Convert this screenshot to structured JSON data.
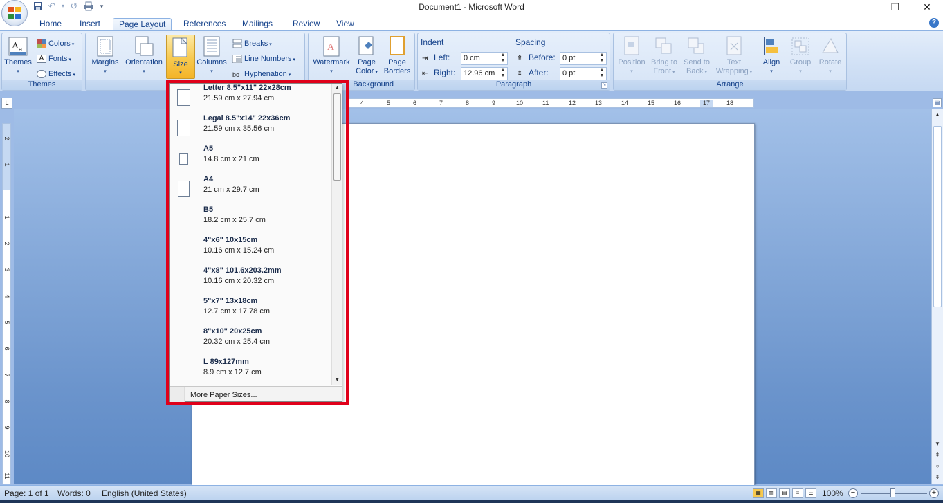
{
  "window": {
    "title": "Document1 - Microsoft Word"
  },
  "tabs": [
    "Home",
    "Insert",
    "Page Layout",
    "References",
    "Mailings",
    "Review",
    "View"
  ],
  "ribbon": {
    "themes": {
      "group": "Themes",
      "themes": "Themes",
      "colors": "Colors",
      "fonts": "Fonts",
      "effects": "Effects"
    },
    "page_setup": {
      "margins": "Margins",
      "orientation": "Orientation",
      "size": "Size",
      "columns": "Columns",
      "breaks": "Breaks",
      "line_numbers": "Line Numbers",
      "hyphenation": "Hyphenation"
    },
    "background": {
      "group": "Background",
      "watermark": "Watermark",
      "page_color_1": "Page",
      "page_color_2": "Color",
      "page_borders_1": "Page",
      "page_borders_2": "Borders"
    },
    "paragraph": {
      "group": "Paragraph",
      "indent": "Indent",
      "left_label": "Left:",
      "left_value": "0 cm",
      "right_label": "Right:",
      "right_value": "12.96 cm",
      "spacing": "Spacing",
      "before_label": "Before:",
      "before_value": "0 pt",
      "after_label": "After:",
      "after_value": "0 pt"
    },
    "arrange": {
      "group": "Arrange",
      "position": "Position",
      "bring_1": "Bring to",
      "bring_2": "Front",
      "send_1": "Send to",
      "send_2": "Back",
      "text_1": "Text",
      "text_2": "Wrapping",
      "align": "Align",
      "group_btn": "Group",
      "rotate": "Rotate"
    }
  },
  "ruler_h": [
    "4",
    "5",
    "6",
    "7",
    "8",
    "9",
    "10",
    "11",
    "12",
    "13",
    "14",
    "15",
    "16",
    "17",
    "18"
  ],
  "ruler_v": [
    "2",
    "1",
    "1",
    "2",
    "3",
    "4",
    "5",
    "6",
    "7",
    "8",
    "9",
    "10",
    "11"
  ],
  "size_menu": {
    "items": [
      {
        "name": "Letter 8.5\"x11\" 22x28cm",
        "dims": "21.59 cm x 27.94 cm"
      },
      {
        "name": "Legal 8.5\"x14\" 22x36cm",
        "dims": "21.59 cm x 35.56 cm"
      },
      {
        "name": "A5",
        "dims": "14.8 cm x 21 cm"
      },
      {
        "name": "A4",
        "dims": "21 cm x 29.7 cm"
      },
      {
        "name": "B5",
        "dims": "18.2 cm x 25.7 cm"
      },
      {
        "name": "4\"x6\" 10x15cm",
        "dims": "10.16 cm x 15.24 cm"
      },
      {
        "name": "4\"x8\" 101.6x203.2mm",
        "dims": "10.16 cm x 20.32 cm"
      },
      {
        "name": "5\"x7\" 13x18cm",
        "dims": "12.7 cm x 17.78 cm"
      },
      {
        "name": "8\"x10\" 20x25cm",
        "dims": "20.32 cm x 25.4 cm"
      },
      {
        "name": "L 89x127mm",
        "dims": "8.9 cm x 12.7 cm"
      }
    ],
    "more": "More Paper Sizes..."
  },
  "status": {
    "page": "Page: 1 of 1",
    "words": "Words: 0",
    "language": "English (United States)",
    "zoom": "100%"
  },
  "colors": {
    "highlight": "#e0001a",
    "active_button": "#f7c94f",
    "ribbon": "#d0e0f5"
  }
}
